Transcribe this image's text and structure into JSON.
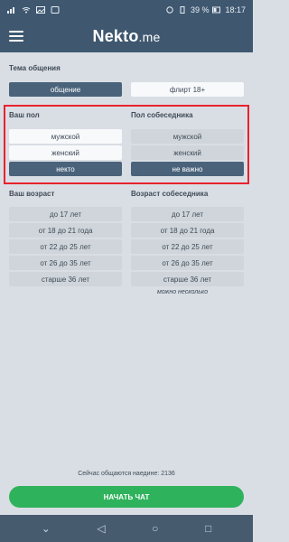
{
  "status_bar": {
    "left_icons": [
      "sim-icon",
      "wifi-icon",
      "image-icon",
      "notification-icon"
    ],
    "battery": "39 %",
    "time": "18:17"
  },
  "header": {
    "logo_main": "Nekto",
    "logo_suffix": ".me"
  },
  "topic": {
    "title": "Тема общения",
    "options": [
      {
        "label": "общение",
        "selected": true
      },
      {
        "label": "флирт 18+",
        "selected": false
      }
    ]
  },
  "your_gender": {
    "title": "Ваш пол",
    "options": [
      {
        "label": "мужской",
        "selected": false
      },
      {
        "label": "женский",
        "selected": false
      },
      {
        "label": "некто",
        "selected": true
      }
    ]
  },
  "partner_gender": {
    "title": "Пол собеседника",
    "options": [
      {
        "label": "мужской",
        "selected": false
      },
      {
        "label": "женский",
        "selected": false
      },
      {
        "label": "не важно",
        "selected": true
      }
    ]
  },
  "your_age": {
    "title": "Ваш возраст",
    "options": [
      "до 17 лет",
      "от 18 до 21 года",
      "от 22 до 25 лет",
      "от 26 до 35 лет",
      "старше 36 лет"
    ]
  },
  "partner_age": {
    "title": "Возраст собеседника",
    "options": [
      "до 17 лет",
      "от 18 до 21 года",
      "от 22 до 25 лет",
      "от 26 до 35 лет",
      "старше 36 лет"
    ],
    "note": "можно несколько"
  },
  "online_text": "Сейчас общаются наедине: 2136",
  "start_button": "НАЧАТЬ ЧАТ",
  "colors": {
    "header": "#3f5870",
    "selected": "#4a637b",
    "start": "#2fb25c",
    "highlight": "#e8222e"
  }
}
